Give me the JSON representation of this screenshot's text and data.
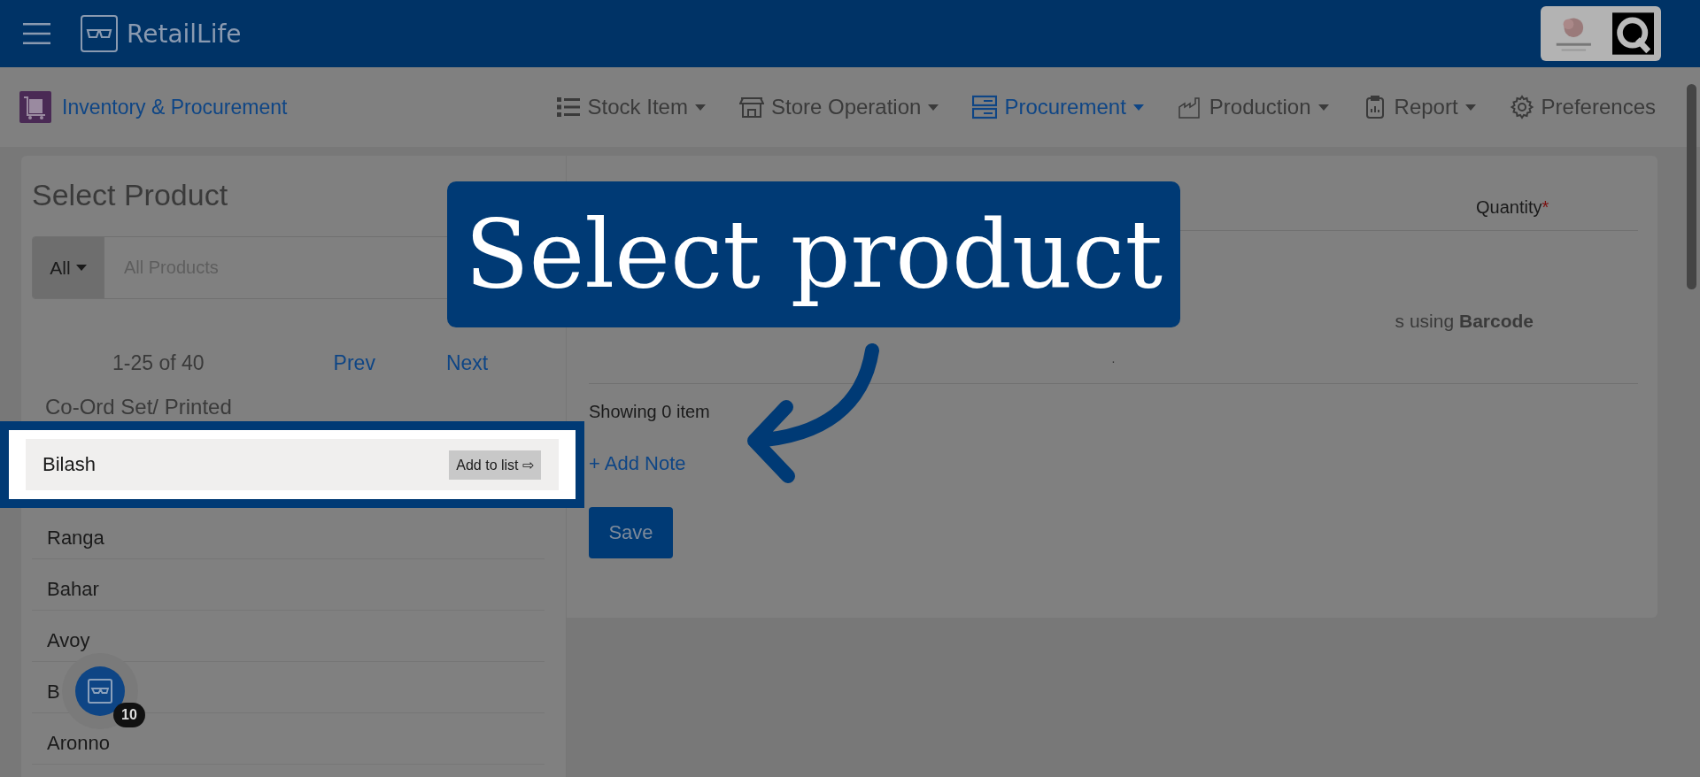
{
  "header": {
    "app_name": "RetailLife"
  },
  "module": {
    "title": "Inventory & Procurement"
  },
  "nav": [
    {
      "label": "Stock Item",
      "dropdown": true,
      "selected": false
    },
    {
      "label": "Store Operation",
      "dropdown": true,
      "selected": false
    },
    {
      "label": "Procurement",
      "dropdown": true,
      "selected": true
    },
    {
      "label": "Production",
      "dropdown": true,
      "selected": false
    },
    {
      "label": "Report",
      "dropdown": true,
      "selected": false
    },
    {
      "label": "Preferences",
      "dropdown": false,
      "selected": false
    }
  ],
  "product_panel": {
    "title": "Select Product",
    "filter": "All",
    "search": {
      "placeholder": "All Products"
    },
    "pagination": {
      "range": "1-25 of 40",
      "prev": "Prev",
      "next": "Next"
    },
    "category": "Co-Ord Set/ Printed",
    "products": [
      {
        "name": "Bilash",
        "highlighted": true,
        "action": "Add to list ⇨"
      },
      {
        "name": "Ranga",
        "highlighted": false
      },
      {
        "name": "Bahar",
        "highlighted": false
      },
      {
        "name": "Avoy",
        "highlighted": false
      },
      {
        "name": "B",
        "highlighted": false
      },
      {
        "name": "Aronno",
        "highlighted": false
      }
    ]
  },
  "order_panel": {
    "column": {
      "label": "Quantity",
      "required_mark": "*"
    },
    "hint": "s using **Barcode**",
    "dot": ".",
    "count": "Showing 0 item",
    "add_note": "+ Add Note",
    "save": "Save"
  },
  "fab": {
    "badge": "10"
  },
  "callout": {
    "text": "Select product"
  }
}
